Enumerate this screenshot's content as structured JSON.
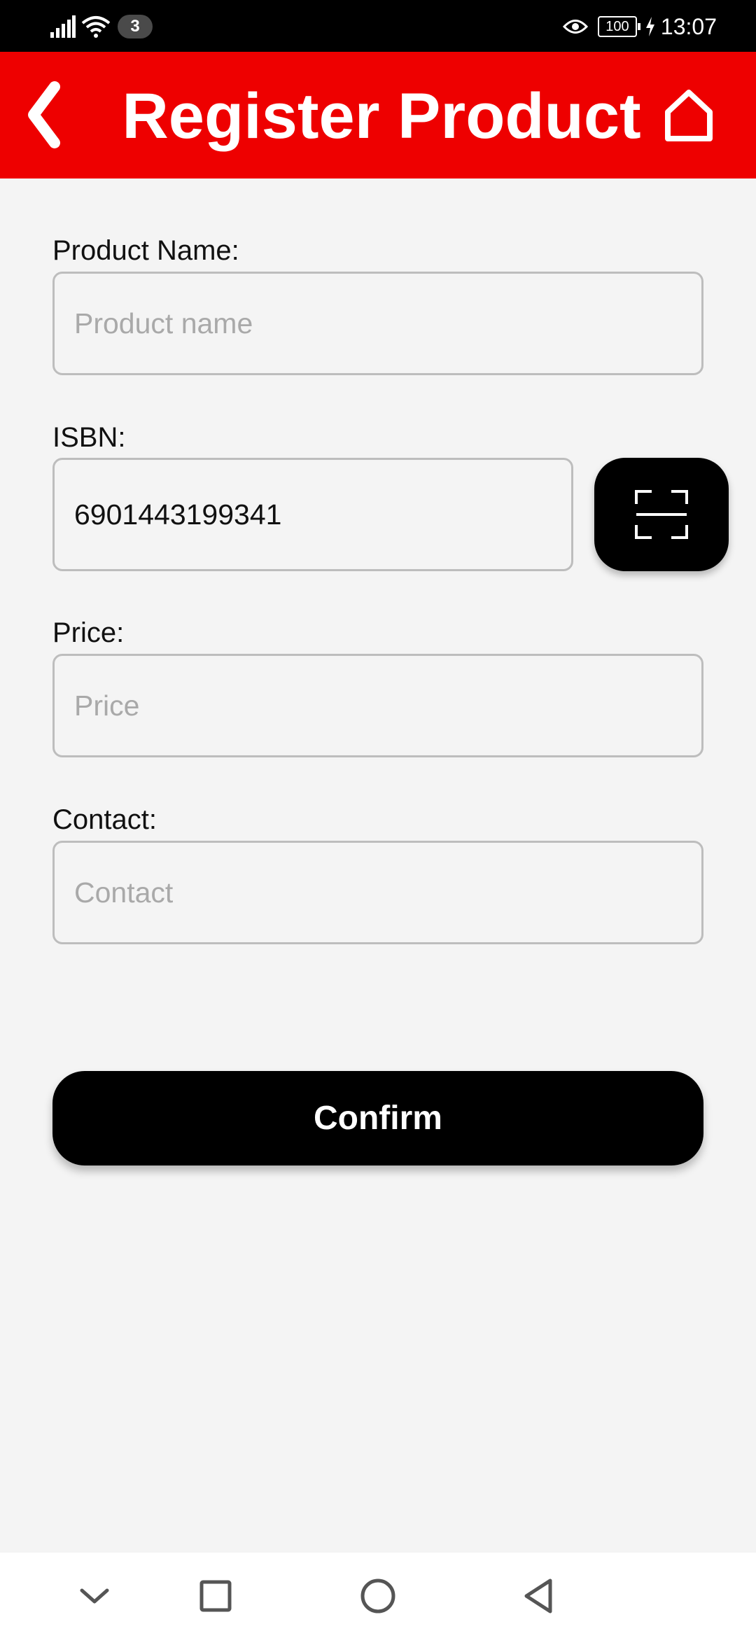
{
  "status_bar": {
    "notification_count": "3",
    "battery_level": "100",
    "time": "13:07",
    "icons": [
      "signal-icon",
      "wifi-icon",
      "eye-icon",
      "battery-icon",
      "charging-icon"
    ]
  },
  "header": {
    "title": "Register Product",
    "back_icon": "chevron-left-icon",
    "home_icon": "home-icon",
    "background_color": "#ee0000"
  },
  "form": {
    "product_name": {
      "label": "Product Name:",
      "value": "",
      "placeholder": "Product name"
    },
    "isbn": {
      "label": "ISBN:",
      "value": "6901443199341",
      "placeholder": ""
    },
    "price": {
      "label": "Price:",
      "value": "",
      "placeholder": "Price"
    },
    "contact": {
      "label": "Contact:",
      "value": "",
      "placeholder": "Contact"
    },
    "scan_icon": "barcode-scan-icon"
  },
  "confirm_label": "Confirm",
  "nav_bar": {
    "icons": [
      "chevron-down-icon",
      "square-icon",
      "circle-icon",
      "triangle-back-icon"
    ]
  }
}
